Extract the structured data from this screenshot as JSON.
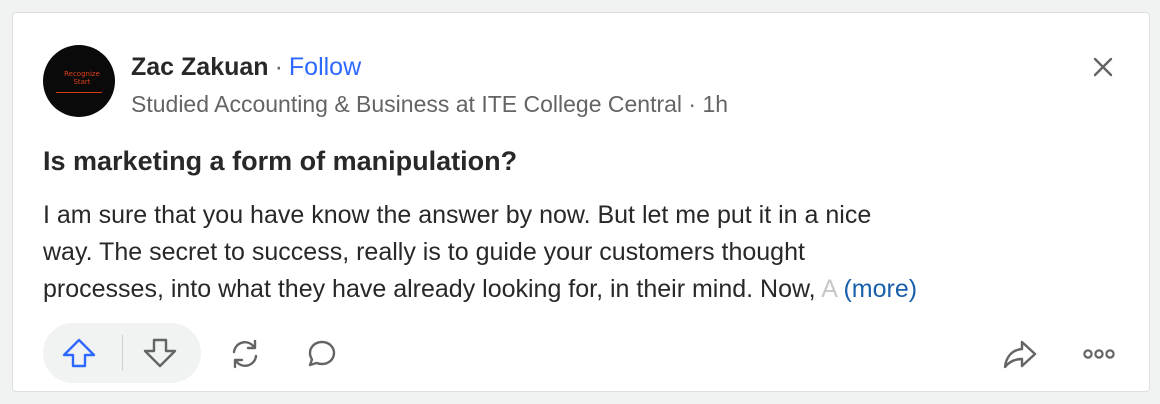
{
  "post": {
    "author": {
      "name": "Zac Zakuan",
      "separator": "·",
      "follow_label": "Follow",
      "credential": "Studied Accounting & Business at ITE College Central",
      "meta_separator": " · ",
      "time": "1h",
      "avatar_text": "Recognize Start"
    },
    "question": "Is marketing a form of manipulation?",
    "answer_lines": [
      "I am sure that you have know the answer by now. But let me put it in a nice",
      "way. The secret to success, really is to guide your customers thought",
      "processes, into what they have already looking for, in their mind. Now,"
    ],
    "answer_fade": " A",
    "more_label": "(more)"
  },
  "actions": {
    "upvote_icon": "upvote-arrow-icon",
    "downvote_icon": "downvote-arrow-icon",
    "share_icon": "reshare-icon",
    "comment_icon": "comment-bubble-icon",
    "forward_icon": "share-arrow-icon",
    "more_icon": "ellipsis-icon",
    "close_icon": "close-icon"
  },
  "colors": {
    "accent": "#2e69ff",
    "more_link": "#195faa",
    "text": "#282829",
    "muted": "#636466",
    "avatar_accent": "#e2411b"
  }
}
